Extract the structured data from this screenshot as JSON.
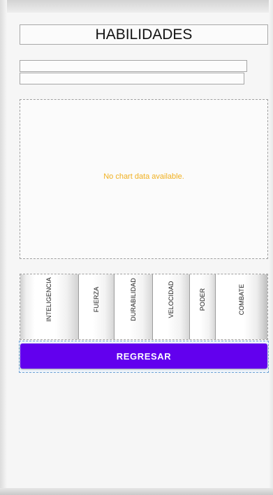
{
  "header": {
    "title": "HABILIDADES"
  },
  "fields": [
    {
      "value": ""
    },
    {
      "value": ""
    }
  ],
  "chart": {
    "empty_message": "No chart data available.",
    "empty_message_color": "#f0b020"
  },
  "tabs": [
    {
      "label": "INTELIGENCIA"
    },
    {
      "label": "FUERZA"
    },
    {
      "label": "DURABILIDAD"
    },
    {
      "label": "VELOCIDAD"
    },
    {
      "label": "PODER"
    },
    {
      "label": "COMBATE"
    }
  ],
  "actions": {
    "back_label": "REGRESAR",
    "back_color": "#6200ee"
  }
}
